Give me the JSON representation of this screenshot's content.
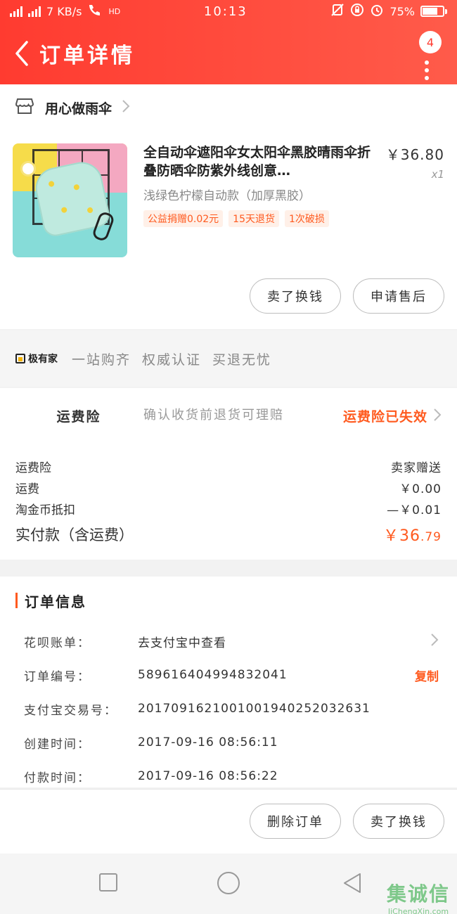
{
  "status_bar": {
    "network": "4G 2G",
    "speed": "7 KB/s",
    "hd": "HD",
    "time": "10:13",
    "battery": "75%",
    "battery_level": 0.75
  },
  "header": {
    "title": "订单详情",
    "badge_count": "4"
  },
  "shop": {
    "name": "用心做雨伞"
  },
  "product": {
    "title": "全自动伞遮阳伞女太阳伞黑胶晴雨伞折叠防晒伞防紫外线创意…",
    "price": "￥36.80",
    "qty": "x1",
    "sku": "浅绿色柠檬自动款（加厚黑胶）",
    "tags": [
      "公益捐赠0.02元",
      "15天退货",
      "1次破损"
    ]
  },
  "product_actions": {
    "sell_label": "卖了换钱",
    "aftersale_label": "申请售后"
  },
  "jiyoujia": {
    "logo_text": "极有家",
    "slogans": [
      "一站购齐",
      "权威认证",
      "买退无忧"
    ]
  },
  "freight_insurance": {
    "label": "运费险",
    "desc": "确认收货前退货可理赔",
    "status": "运费险已失效"
  },
  "fees": {
    "rows": [
      {
        "label": "运费险",
        "value": "卖家赠送"
      },
      {
        "label": "运费",
        "value": "￥0.00"
      },
      {
        "label": "淘金币抵扣",
        "value": "—￥0.01"
      }
    ],
    "total_label": "实付款（含运费）",
    "total_int": "￥36",
    "total_dec": ".79"
  },
  "order_info": {
    "title": "订单信息",
    "huabei_label": "花呗账单：",
    "huabei_value": "去支付宝中查看",
    "order_no_label": "订单编号：",
    "order_no_value": "589616404994832041",
    "copy_label": "复制",
    "alipay_label": "支付宝交易号：",
    "alipay_value": "2017091621001001940252032631",
    "created_label": "创建时间：",
    "created_value": "2017-09-16 08:56:11",
    "paid_label": "付款时间：",
    "paid_value": "2017-09-16 08:56:22"
  },
  "bottom_actions": {
    "delete_label": "删除订单",
    "sell_label": "卖了换钱"
  },
  "watermark": {
    "logo": "集诚信",
    "url": "JiChengXin.com"
  }
}
